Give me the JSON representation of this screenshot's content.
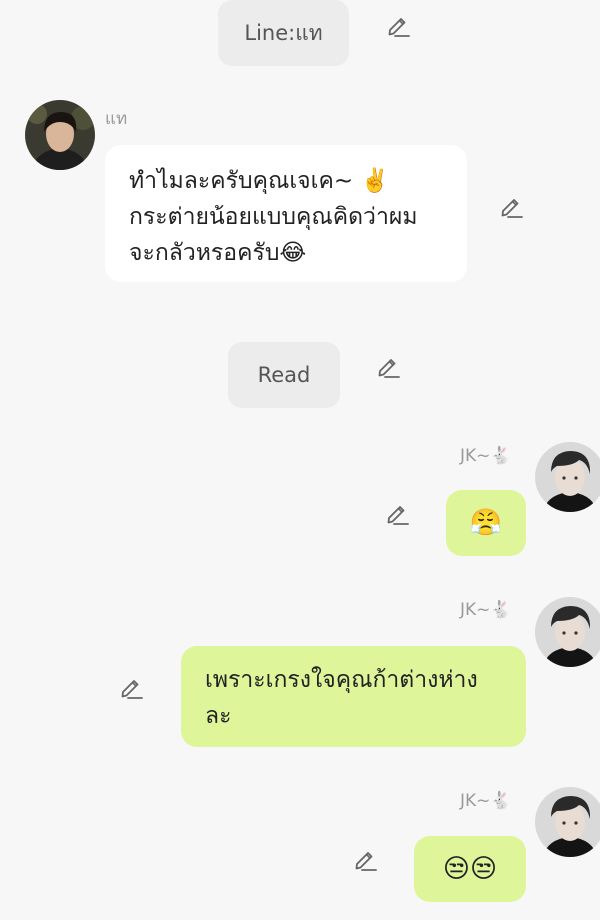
{
  "system_pills": {
    "top": "Line:แท",
    "read": "Read"
  },
  "messages": [
    {
      "sender": "แท",
      "side": "left",
      "lines": [
        "ทำไมละครับคุณเจเค~ ✌️",
        "กระต่ายน้อยแบบคุณคิดว่าผม",
        "จะกลัวหรอครับ😂"
      ]
    },
    {
      "sender": "JK~🐇",
      "side": "right",
      "emoji": "😤"
    },
    {
      "sender": "JK~🐇",
      "side": "right",
      "lines": [
        "เพราะเกรงใจคุณก้าต่างห่าง",
        "ละ"
      ]
    },
    {
      "sender": "JK~🐇",
      "side": "right",
      "emoji": "😒😒"
    }
  ],
  "icons": {
    "edit": "pencil-icon"
  },
  "colors": {
    "background": "#f7f7f7",
    "pill": "#ececec",
    "incoming_bubble": "#ffffff",
    "outgoing_bubble": "#def59a"
  }
}
